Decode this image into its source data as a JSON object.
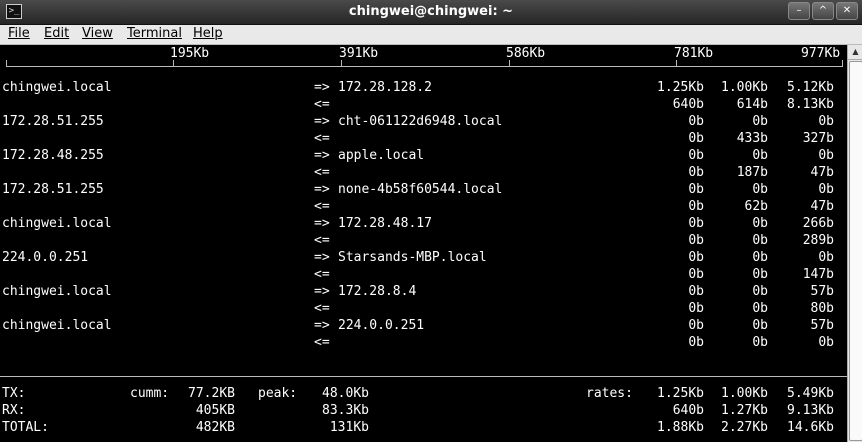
{
  "window": {
    "title": "chingwei@chingwei: ~",
    "buttons": [
      "–",
      "^",
      "✕"
    ]
  },
  "menu": [
    "File",
    "Edit",
    "View",
    "Terminal",
    "Help"
  ],
  "scale": [
    "195Kb",
    "391Kb",
    "586Kb",
    "781Kb",
    "977Kb"
  ],
  "flows": [
    {
      "src": "chingwei.local",
      "dst": "172.28.128.2",
      "out": [
        "1.25Kb",
        "1.00Kb",
        "5.12Kb"
      ],
      "in": [
        "640b",
        "614b",
        "8.13Kb"
      ]
    },
    {
      "src": "172.28.51.255",
      "dst": "cht-061122d6948.local",
      "out": [
        "0b",
        "0b",
        "0b"
      ],
      "in": [
        "0b",
        "433b",
        "327b"
      ]
    },
    {
      "src": "172.28.48.255",
      "dst": "apple.local",
      "out": [
        "0b",
        "0b",
        "0b"
      ],
      "in": [
        "0b",
        "187b",
        "47b"
      ]
    },
    {
      "src": "172.28.51.255",
      "dst": "none-4b58f60544.local",
      "out": [
        "0b",
        "0b",
        "0b"
      ],
      "in": [
        "0b",
        "62b",
        "47b"
      ]
    },
    {
      "src": "chingwei.local",
      "dst": "172.28.48.17",
      "out": [
        "0b",
        "0b",
        "266b"
      ],
      "in": [
        "0b",
        "0b",
        "289b"
      ]
    },
    {
      "src": "224.0.0.251",
      "dst": "Starsands-MBP.local",
      "out": [
        "0b",
        "0b",
        "0b"
      ],
      "in": [
        "0b",
        "0b",
        "147b"
      ]
    },
    {
      "src": "chingwei.local",
      "dst": "172.28.8.4",
      "out": [
        "0b",
        "0b",
        "57b"
      ],
      "in": [
        "0b",
        "0b",
        "80b"
      ]
    },
    {
      "src": "chingwei.local",
      "dst": "224.0.0.251",
      "out": [
        "0b",
        "0b",
        "57b"
      ],
      "in": [
        "0b",
        "0b",
        "0b"
      ]
    }
  ],
  "arrows": {
    "out": "=>",
    "in": "<="
  },
  "totals": {
    "cumm_label": "cumm:",
    "peak_label": "peak:",
    "rates_label": "rates:",
    "rows": [
      {
        "label": "TX:",
        "cumm": "77.2KB",
        "peak": "48.0Kb",
        "rates": [
          "1.25Kb",
          "1.00Kb",
          "5.49Kb"
        ]
      },
      {
        "label": "RX:",
        "cumm": "405KB",
        "peak": "83.3Kb",
        "rates": [
          "640b",
          "1.27Kb",
          "9.13Kb"
        ]
      },
      {
        "label": "TOTAL:",
        "cumm": "482KB",
        "peak": "131Kb",
        "rates": [
          "1.88Kb",
          "2.27Kb",
          "14.6Kb"
        ]
      }
    ]
  }
}
